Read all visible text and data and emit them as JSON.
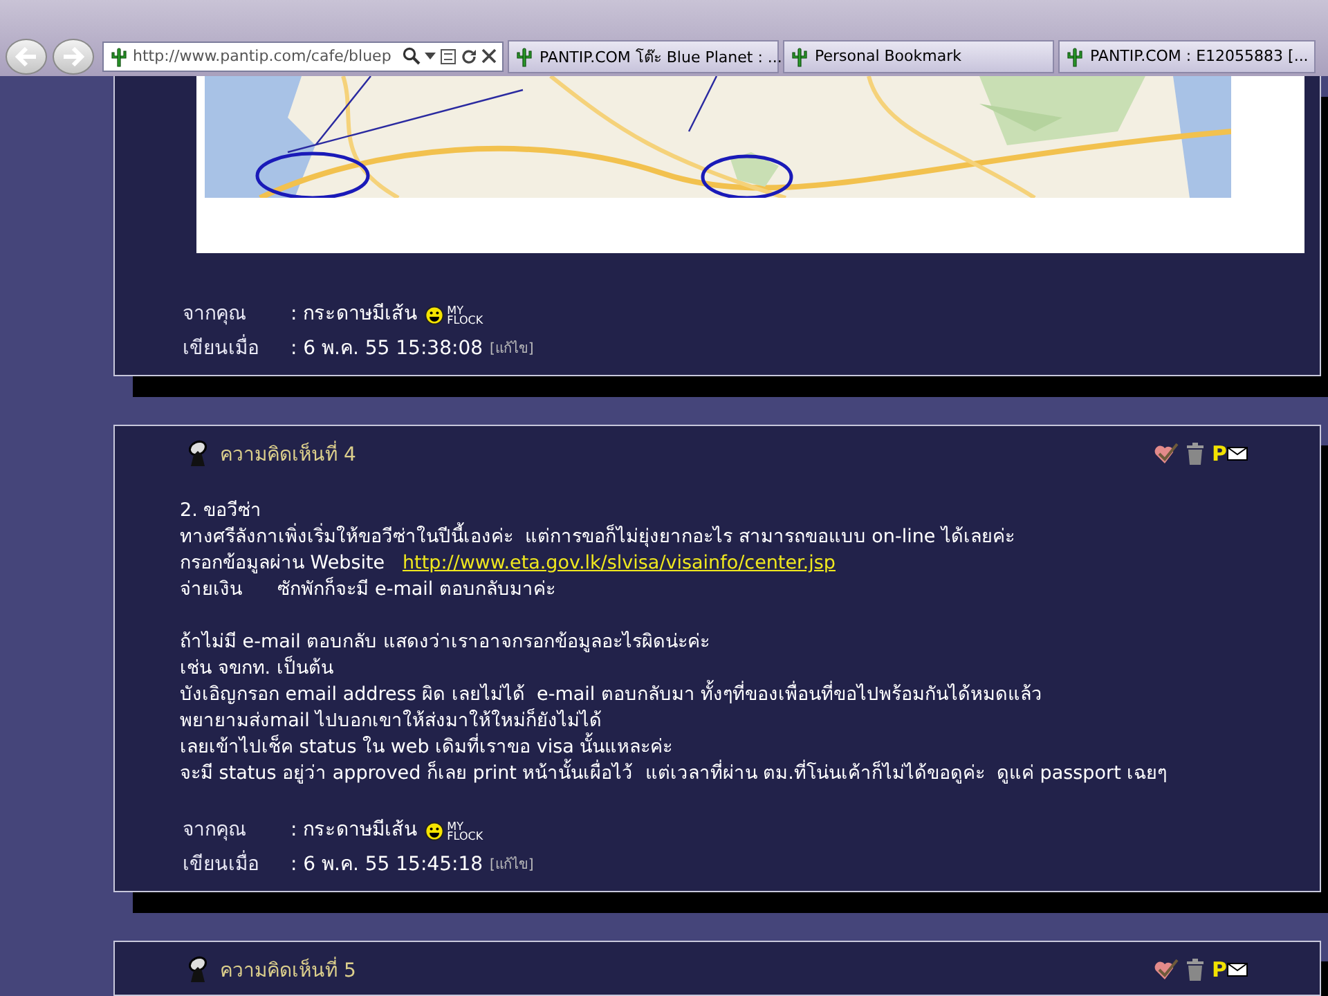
{
  "browser": {
    "address": "http://www.pantip.com/cafe/bluep",
    "tabs": [
      {
        "label": "PANTIP.COM โต๊ะ Blue Planet : ..."
      },
      {
        "label": "Personal Bookmark"
      },
      {
        "label": "PANTIP.COM : E12055883 [..."
      }
    ]
  },
  "posts": [
    {
      "kind": "picture",
      "author_label": "จากคุณ",
      "author": ": กระดาษมีเส้น",
      "badge_top": "MY",
      "badge_bottom": "FLOCK",
      "date_label": "เขียนเมื่อ",
      "date": ": 6 พ.ค. 55 15:38:08",
      "edit": "[แก้ไข]"
    },
    {
      "kind": "comment",
      "title": "ความคิดเห็นที่ 4",
      "pm_letter": "P",
      "paragraphs": [
        [
          {
            "text": "2. ขอวีซ่า"
          },
          {
            "text": "ทางศรีลังกาเพิ่งเริ่มให้ขอวีซ่าในปีนี้เองค่ะ  แต่การขอก็ไม่ยุ่งยากอะไร สามารถขอแบบ on-line ได้เลยค่ะ"
          },
          {
            "text": "กรอกข้อมูลผ่าน Website   ",
            "link": "http://www.eta.gov.lk/slvisa/visainfo/center.jsp"
          },
          {
            "text": "จ่ายเงิน      ซักพักก็จะมี e-mail ตอบกลับมาค่ะ"
          }
        ],
        [
          {
            "text": "ถ้าไม่มี e-mail ตอบกลับ แสดงว่าเราอาจกรอกข้อมูลอะไรผิดน่ะค่ะ"
          },
          {
            "text": "เช่น จขกท. เป็นต้น"
          },
          {
            "text": "บังเอิญกรอก email address ผิด เลยไม่ได้  e-mail ตอบกลับมา ทั้งๆที่ของเพื่อนที่ขอไปพร้อมกันได้หมดแล้ว"
          },
          {
            "text": "พยายามส่งmail ไปบอกเขาให้ส่งมาให้ใหม่ก็ยังไม่ได้"
          },
          {
            "text": "เลยเข้าไปเช็ค status ใน web เดิมที่เราขอ visa นั้นแหละค่ะ"
          },
          {
            "text": "จะมี status อยู่ว่า approved ก็เลย print หน้านั้นเผื่อไว้  แต่เวลาที่ผ่าน ตม.ที่โน่นเค้าก็ไม่ได้ขอดูค่ะ  ดูแค่ passport เฉยๆ"
          }
        ]
      ],
      "author_label": "จากคุณ",
      "author": ": กระดาษมีเส้น",
      "badge_top": "MY",
      "badge_bottom": "FLOCK",
      "date_label": "เขียนเมื่อ",
      "date": ": 6 พ.ค. 55 15:45:18",
      "edit": "[แก้ไข]"
    },
    {
      "kind": "comment",
      "title": "ความคิดเห็นที่ 5",
      "pm_letter": "P"
    }
  ]
}
